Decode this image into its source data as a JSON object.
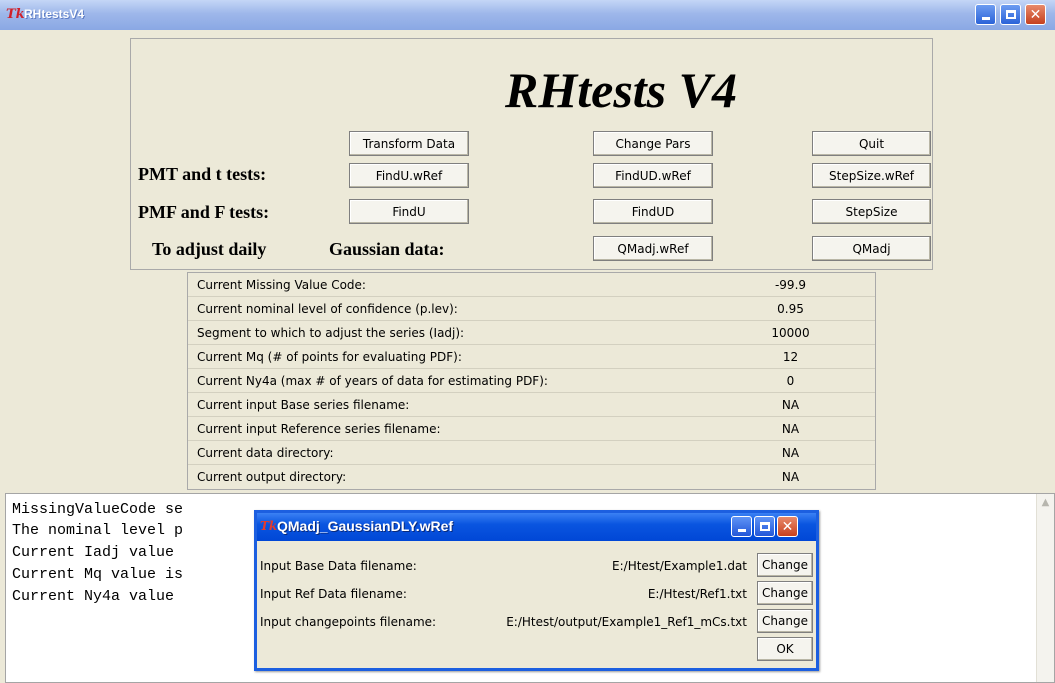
{
  "window": {
    "title": "RHtestsV4",
    "logo": "Tk"
  },
  "header": {
    "app_title": "RHtests V4",
    "rows": {
      "pmt_label": "PMT and t tests:",
      "pmf_label": "PMF and F tests:",
      "adjust_label": "To adjust daily",
      "gaussian_label": "Gaussian data:"
    },
    "buttons": {
      "transform_data": "Transform Data",
      "change_pars": "Change Pars",
      "quit": "Quit",
      "findu_wref": "FindU.wRef",
      "findud_wref": "FindUD.wRef",
      "stepsize_wref": "StepSize.wRef",
      "findu": "FindU",
      "findud": "FindUD",
      "stepsize": "StepSize",
      "qmadj_wref": "QMadj.wRef",
      "qmadj": "QMadj"
    }
  },
  "settings": [
    {
      "label": "Current Missing Value Code:",
      "value": "-99.9"
    },
    {
      "label": "Current nominal level of confidence (p.lev):",
      "value": "0.95"
    },
    {
      "label": "Segment to which to adjust the series (Iadj):",
      "value": "10000"
    },
    {
      "label": "Current Mq (# of points for evaluating PDF):",
      "value": "12"
    },
    {
      "label": "Current Ny4a (max # of years of data for estimating PDF):",
      "value": "0"
    },
    {
      "label": "Current input Base series filename:",
      "value": "NA"
    },
    {
      "label": "Current input Reference series filename:",
      "value": "NA"
    },
    {
      "label": "Current data directory:",
      "value": "NA"
    },
    {
      "label": "Current output directory:",
      "value": "NA"
    }
  ],
  "console": {
    "lines": [
      "MissingValueCode set to: -99.9",
      "The nominal level p.lev is: 0.95",
      "Current Iadj value is: 10000",
      "Current Mq value is: 12",
      "Current Ny4a value is: 0"
    ],
    "visible_lines": [
      "MissingValueCode se",
      "The nominal level p",
      "Current Iadj value",
      "Current Mq value is",
      "Current Ny4a value"
    ]
  },
  "dialog": {
    "title": "QMadj_GaussianDLY.wRef",
    "rows": [
      {
        "label": "Input Base Data filename:",
        "value": "E:/Htest/Example1.dat",
        "button": "Change"
      },
      {
        "label": "Input Ref Data filename:",
        "value": "E:/Htest/Ref1.txt",
        "button": "Change"
      },
      {
        "label": "Input changepoints filename:",
        "value": "E:/Htest/output/Example1_Ref1_mCs.txt",
        "button": "Change"
      }
    ],
    "ok_label": "OK"
  }
}
